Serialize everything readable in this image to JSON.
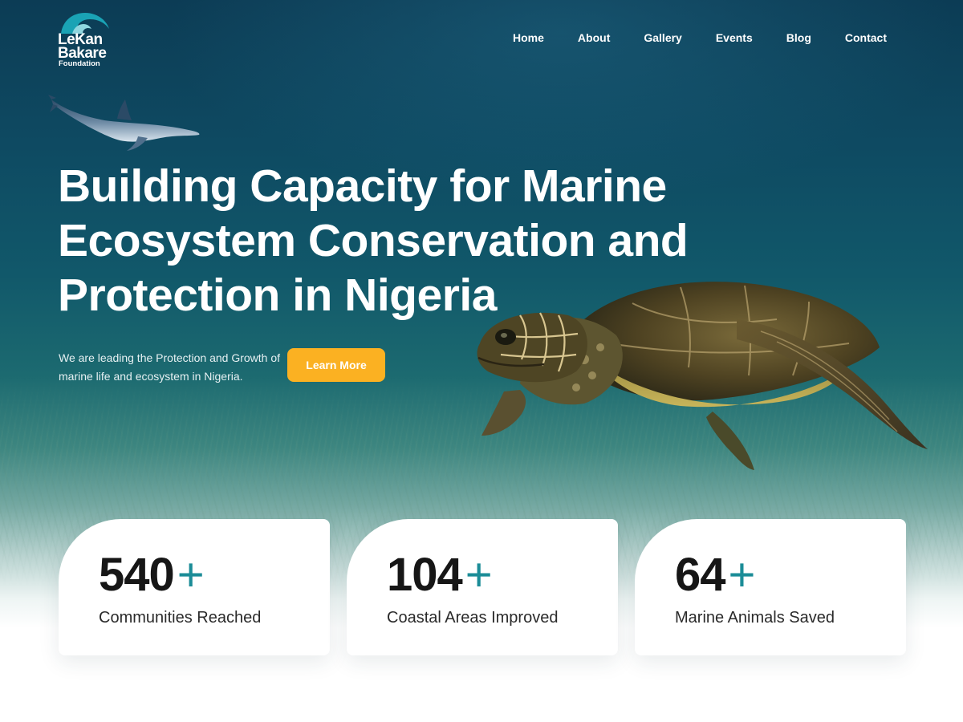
{
  "logo": {
    "line1": "LeKan",
    "line2": "Bakare",
    "line3": "Foundation"
  },
  "nav": {
    "items": [
      "Home",
      "About",
      "Gallery",
      "Events",
      "Blog",
      "Contact"
    ]
  },
  "hero": {
    "headline": "Building Capacity for Marine Ecosystem Conservation and Protection in Nigeria",
    "subtext": "We are leading the Protection and Growth of marine life and ecosystem in Nigeria.",
    "cta_label": "Learn More"
  },
  "stats": [
    {
      "number": "540",
      "suffix": "+",
      "label": "Communities Reached"
    },
    {
      "number": "104",
      "suffix": "+",
      "label": "Coastal Areas Improved"
    },
    {
      "number": "64",
      "suffix": "+",
      "label": "Marine Animals Saved"
    }
  ],
  "colors": {
    "accent": "#fbb122",
    "plus": "#1b8c97",
    "ocean_dark": "#0c3c55",
    "ocean_mid": "#1c6a70"
  }
}
